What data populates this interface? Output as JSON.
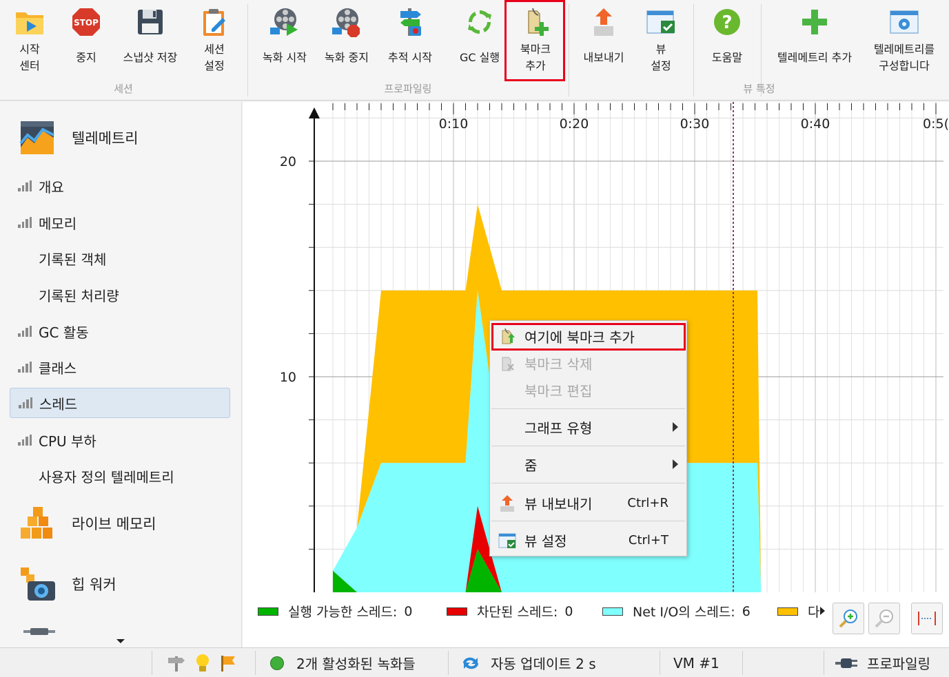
{
  "toolbar": {
    "start_center": [
      "시작",
      "센터"
    ],
    "stop": "중지",
    "save_snapshot": "스냅샷 저장",
    "session_settings": [
      "세션",
      "설정"
    ],
    "start_recording": "녹화 시작",
    "stop_recording": "녹화 중지",
    "start_tracking": "추적 시작",
    "run_gc": "GC 실행",
    "add_bookmark": [
      "북마크",
      "추가"
    ],
    "export": "내보내기",
    "view_settings": [
      "뷰",
      "설정"
    ],
    "help": "도움말",
    "add_telemetry": "텔레메트리 추가",
    "configure_telemetry": [
      "텔레메트리를",
      "구성합니다"
    ],
    "groups": {
      "session": "세션",
      "profiling": "프로파일링",
      "view_specific": "뷰 특정"
    }
  },
  "sidebar": {
    "telemetry": "텔레메트리",
    "items": [
      {
        "label": "개요",
        "icon": "bar-chart-icon"
      },
      {
        "label": "메모리",
        "icon": "bar-chart-icon"
      },
      {
        "label": "기록된 객체",
        "icon": ""
      },
      {
        "label": "기록된 처리량",
        "icon": ""
      },
      {
        "label": "GC 활동",
        "icon": "bar-chart-icon"
      },
      {
        "label": "클래스",
        "icon": "bar-chart-icon"
      },
      {
        "label": "스레드",
        "icon": "bar-chart-icon",
        "selected": true
      },
      {
        "label": "CPU 부하",
        "icon": "bar-chart-icon"
      },
      {
        "label": "사용자 정의 텔레메트리",
        "icon": ""
      }
    ],
    "live_memory": "라이브 메모리",
    "heap_walker": "힙 워커"
  },
  "chart_data": {
    "type": "area",
    "stacked": true,
    "x": [
      0,
      2,
      4,
      6,
      11,
      12,
      14,
      20,
      25,
      30,
      35,
      35.2,
      35.5
    ],
    "x_tick_labels": [
      "0:10",
      "0:20",
      "0:30",
      "0:40",
      "0:5("
    ],
    "x_ticks": [
      10,
      20,
      30,
      40,
      50
    ],
    "xlim": [
      0,
      50
    ],
    "y_tick_labels": [
      "20",
      "10"
    ],
    "y_ticks": [
      20,
      10
    ],
    "ylim": [
      0,
      23
    ],
    "bookmark_x": 33.2,
    "series": [
      {
        "name": "실행 가능한 스레드",
        "color": "#00b400",
        "values": [
          1,
          0,
          0,
          0,
          0,
          2,
          0,
          0,
          0,
          0,
          0,
          0,
          0
        ]
      },
      {
        "name": "차단된 스레드",
        "color": "#e80000",
        "values": [
          0,
          0,
          0,
          0,
          0,
          2,
          0,
          0,
          0,
          0,
          0,
          0,
          0
        ]
      },
      {
        "name": "Net I/O의 스레드",
        "color": "#80ffff",
        "values": [
          0,
          3,
          6,
          6,
          6,
          10,
          6,
          6,
          6,
          6,
          6,
          6,
          0
        ]
      },
      {
        "name": "다",
        "color": "#ffc000",
        "values": [
          0,
          0,
          8,
          8,
          8,
          4,
          8,
          8,
          8,
          8,
          8,
          8,
          0
        ]
      }
    ],
    "legend": [
      {
        "label": "실행 가능한 스레드:",
        "value": "0",
        "color": "#00b400"
      },
      {
        "label": "차단된 스레드:",
        "value": "0",
        "color": "#e80000"
      },
      {
        "label": "Net I/O의 스레드:",
        "value": "6",
        "color": "#80ffff"
      },
      {
        "label": "다",
        "value": "",
        "color": "#ffc000"
      }
    ]
  },
  "context_menu": {
    "add_bookmark_here": "여기에 북마크 추가",
    "delete_bookmark": "북마크 삭제",
    "edit_bookmark": "북마크 편집",
    "graph_type": "그래프 유형",
    "zoom": "줌",
    "export_view": "뷰 내보내기",
    "export_shortcut": "Ctrl+R",
    "view_settings": "뷰 설정",
    "settings_shortcut": "Ctrl+T"
  },
  "statusbar": {
    "recordings": "2개 활성화된 녹화들",
    "auto_update": "자동 업데이트 2 s",
    "vm": "VM #1",
    "profiling": "프로파일링"
  }
}
